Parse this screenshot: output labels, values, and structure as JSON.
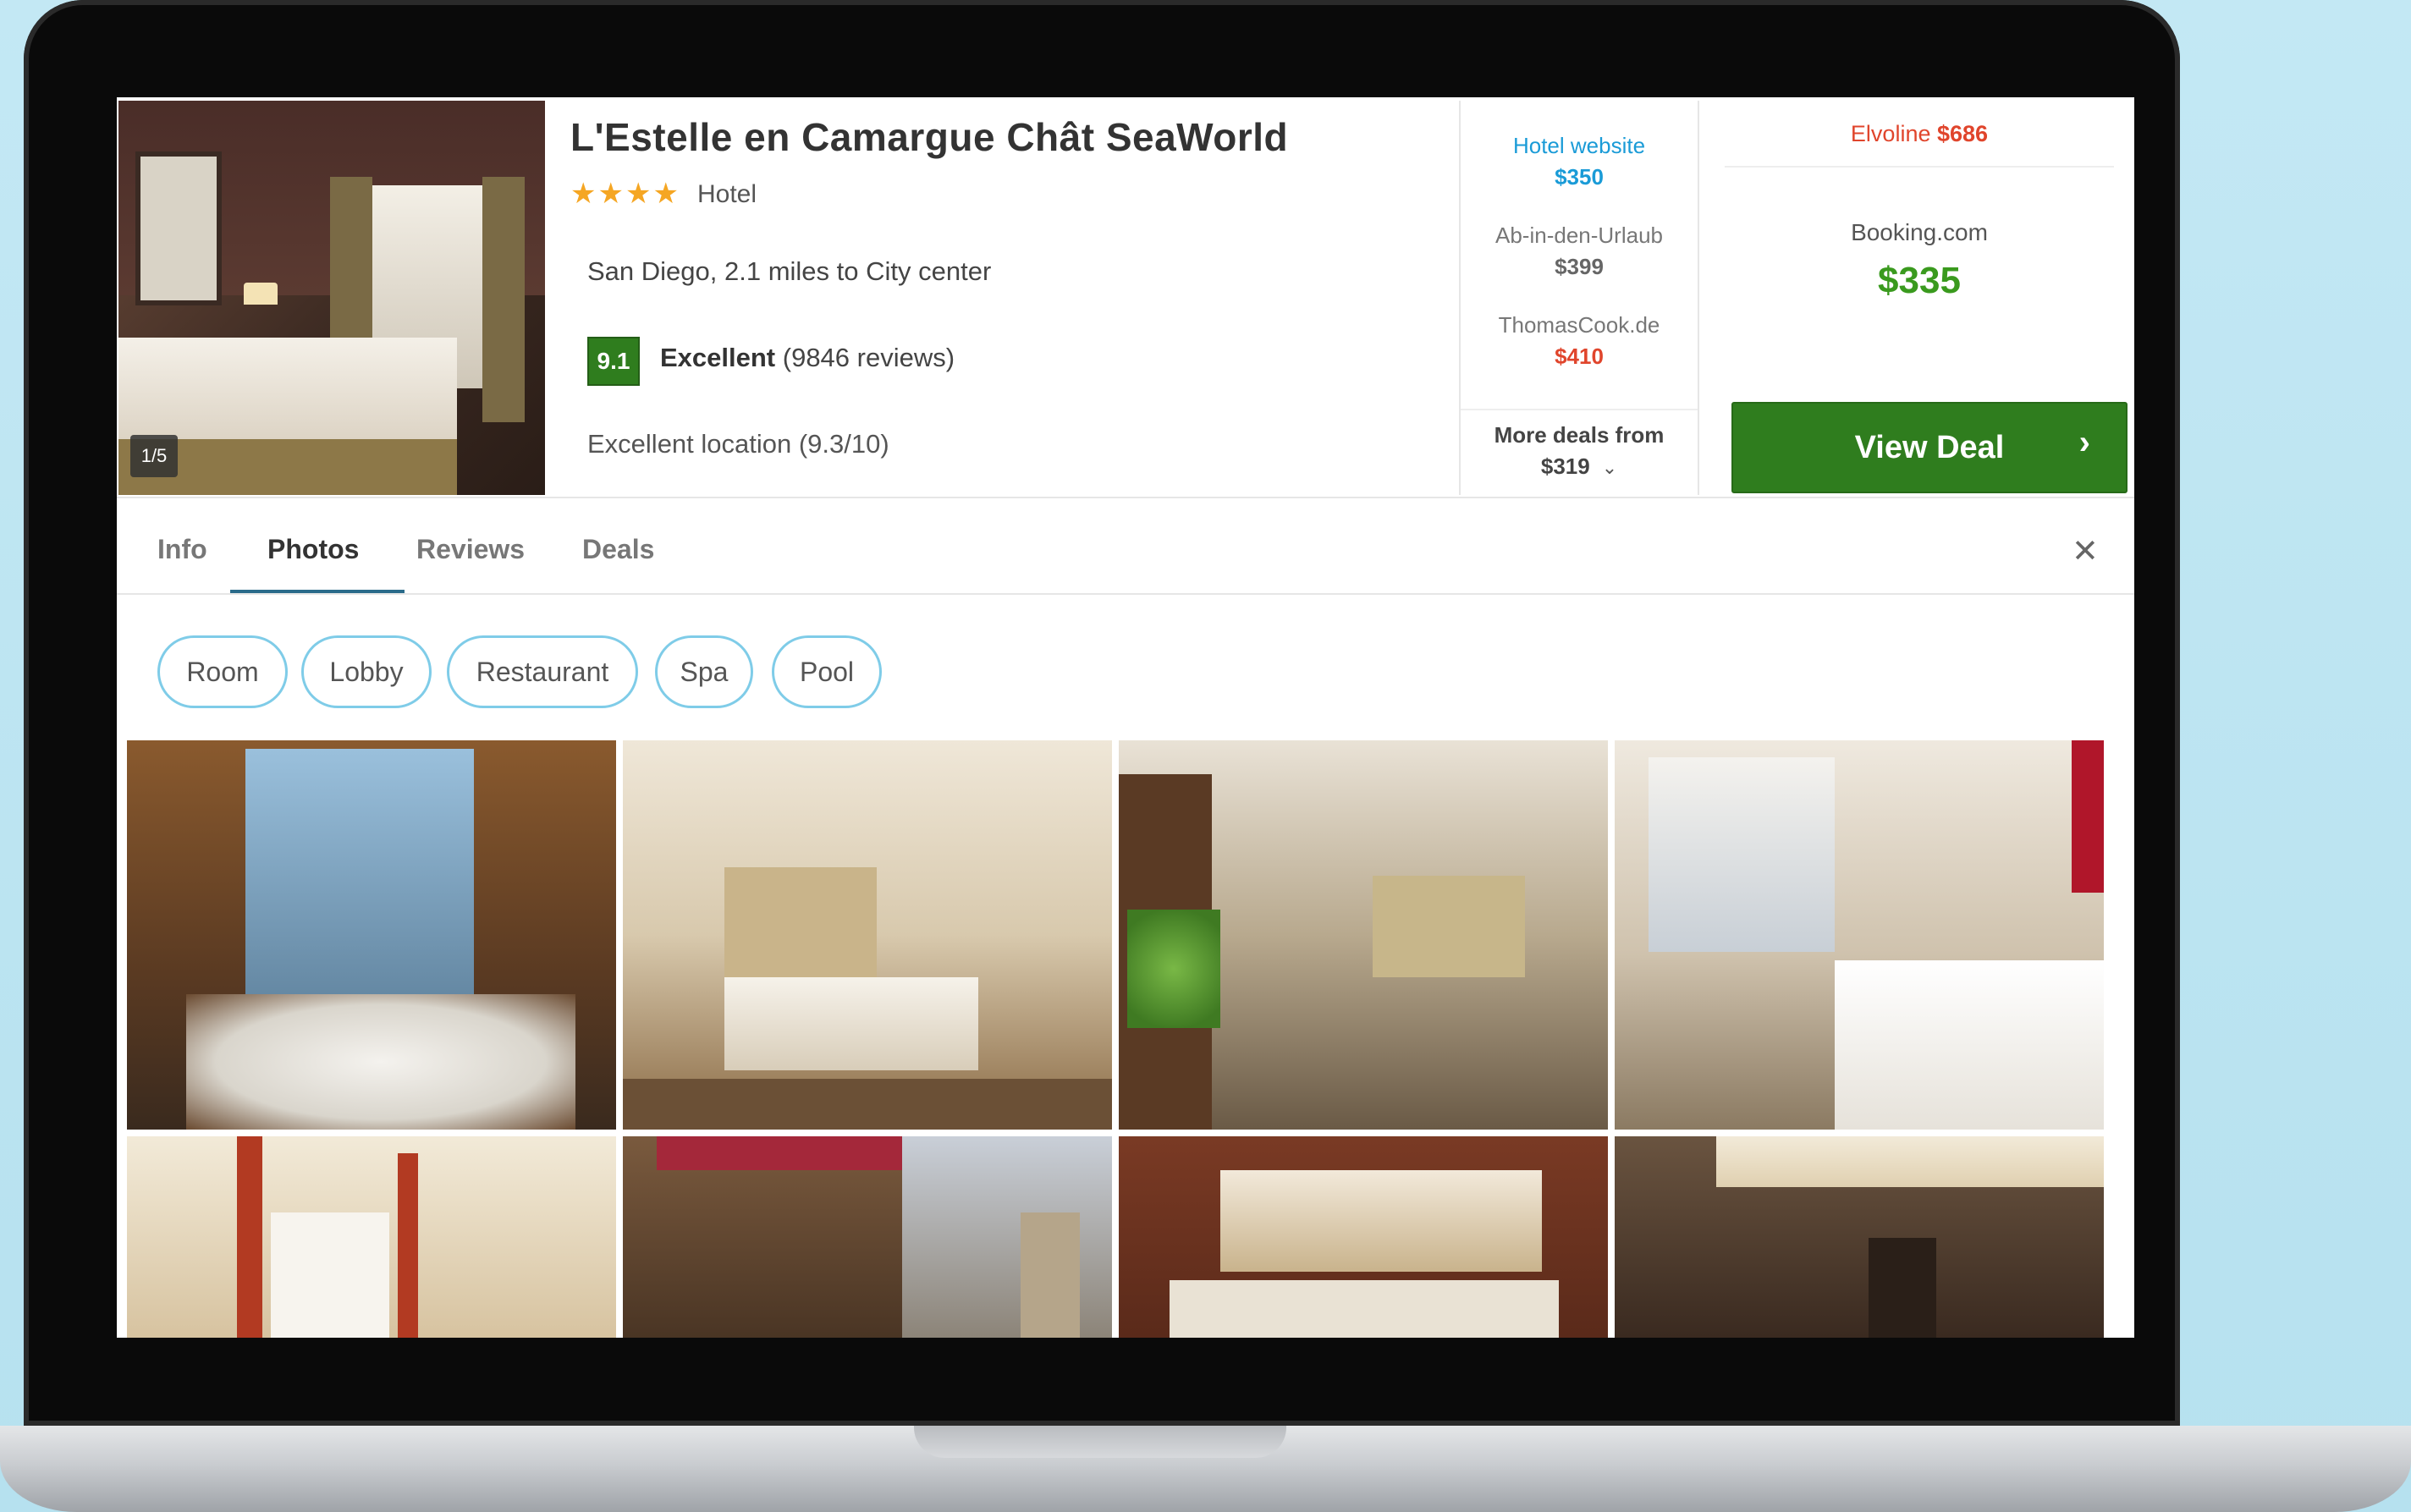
{
  "hotel": {
    "photo_counter": "1/5",
    "name": "L'Estelle en Camargue Chât SeaWorld",
    "stars": "★★★★",
    "type": "Hotel",
    "location": "San Diego, 2.1 miles to City center",
    "score": "9.1",
    "rating_label": "Excellent",
    "reviews": "(9846 reviews)",
    "location_score": "Excellent location (9.3/10)"
  },
  "deals": [
    {
      "provider": "Hotel website",
      "price": "$350"
    },
    {
      "provider": "Ab-in-den-Urlaub",
      "price": "$399"
    },
    {
      "provider": "ThomasCook.de",
      "price": "$410"
    }
  ],
  "more_deals": {
    "label": "More deals from",
    "price": "$319"
  },
  "featured": {
    "top_offer_provider": "Elvoline",
    "top_offer_price": "$686",
    "provider": "Booking.com",
    "price": "$335",
    "button": "View Deal"
  },
  "tabs": [
    "Info",
    "Photos",
    "Reviews",
    "Deals"
  ],
  "active_tab": "Photos",
  "categories": [
    "Room",
    "Lobby",
    "Restaurant",
    "Spa",
    "Pool"
  ],
  "colors": {
    "accent_green": "#2f7d1e",
    "price_green": "#3a9a1e",
    "price_red": "#e0452c",
    "link_blue": "#1a9bd7",
    "chip_border": "#7fcce8"
  },
  "icons": [
    "chevron-down-icon",
    "chevron-right-icon",
    "close-icon",
    "star-icon"
  ]
}
